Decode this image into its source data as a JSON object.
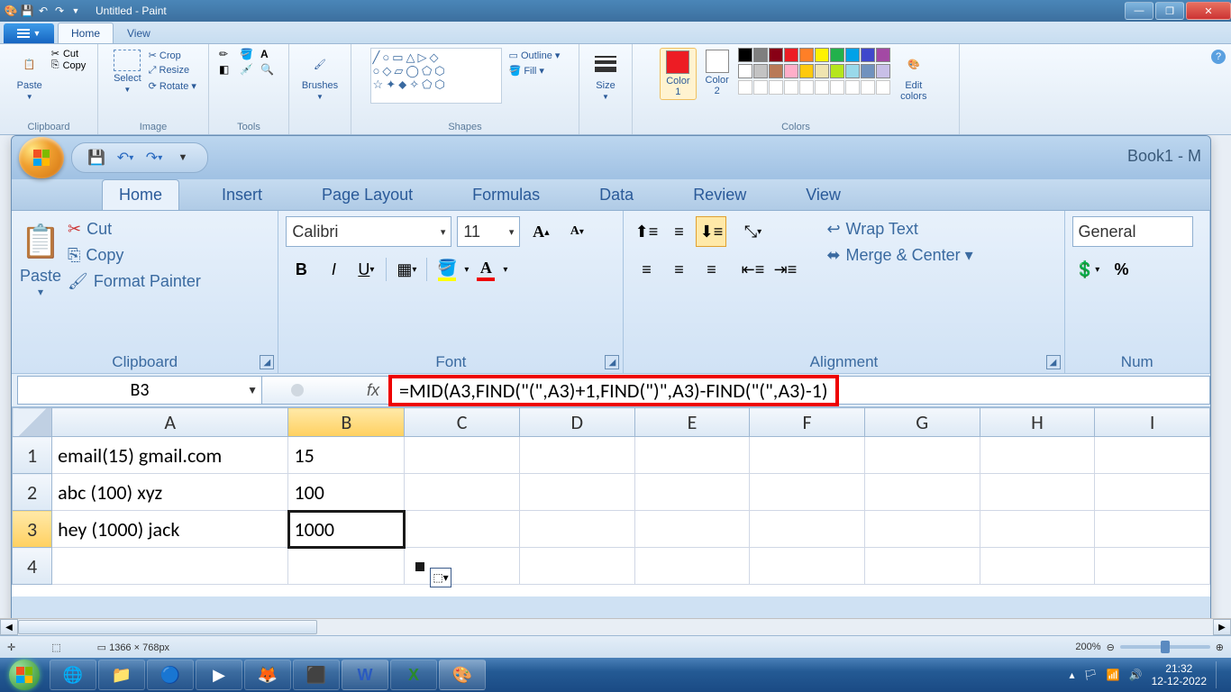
{
  "paint": {
    "title": "Untitled - Paint",
    "file_label": "▾",
    "tabs": {
      "home": "Home",
      "view": "View"
    },
    "clipboard": {
      "paste": "Paste",
      "cut": "Cut",
      "copy": "Copy",
      "label": "Clipboard"
    },
    "image": {
      "select": "Select",
      "crop": "Crop",
      "resize": "Resize",
      "rotate": "Rotate ▾",
      "label": "Image"
    },
    "tools": {
      "label": "Tools"
    },
    "brushes": {
      "label": "Brushes",
      "btn": "Brushes"
    },
    "shapes": {
      "outline": "Outline ▾",
      "fill": "Fill ▾",
      "label": "Shapes"
    },
    "size": {
      "btn": "Size",
      "label": ""
    },
    "colors": {
      "c1": "Color\n1",
      "c2": "Color\n2",
      "edit": "Edit\ncolors",
      "label": "Colors"
    },
    "status": {
      "pos": "",
      "dim": "1366 × 768px",
      "zoom_pct": "200%",
      "sep": "⊟"
    }
  },
  "excel": {
    "book": "Book1 - M",
    "tabs": {
      "home": "Home",
      "insert": "Insert",
      "pagelayout": "Page Layout",
      "formulas": "Formulas",
      "data": "Data",
      "review": "Review",
      "view": "View"
    },
    "clipboard": {
      "paste": "Paste",
      "cut": "Cut",
      "copy": "Copy",
      "formatpainter": "Format Painter",
      "label": "Clipboard"
    },
    "font": {
      "name": "Calibri",
      "size": "11",
      "label": "Font"
    },
    "alignment": {
      "wrap": "Wrap Text",
      "merge": "Merge & Center ▾",
      "label": "Alignment"
    },
    "number": {
      "general": "General",
      "label": "Num"
    },
    "namebox": "B3",
    "fx_label": "fx",
    "formula": "=MID(A3,FIND(\"(\",A3)+1,FIND(\")\",A3)-FIND(\"(\",A3)-1)",
    "cols": [
      "A",
      "B",
      "C",
      "D",
      "E",
      "F",
      "G",
      "H",
      "I"
    ],
    "rows": [
      {
        "n": "1",
        "A": "email(15) gmail.com",
        "B": "15"
      },
      {
        "n": "2",
        "A": "abc (100) xyz",
        "B": "100"
      },
      {
        "n": "3",
        "A": "hey (1000) jack",
        "B": "1000"
      },
      {
        "n": "4",
        "A": "",
        "B": ""
      }
    ]
  },
  "palette": {
    "row1": [
      "#000000",
      "#7f7f7f",
      "#880015",
      "#ed1c24",
      "#ff7f27",
      "#fff200",
      "#22b14c",
      "#00a2e8",
      "#3f48cc",
      "#a349a4"
    ],
    "row2": [
      "#ffffff",
      "#c3c3c3",
      "#b97a57",
      "#ffaec9",
      "#ffc90e",
      "#efe4b0",
      "#b5e61d",
      "#99d9ea",
      "#7092be",
      "#c8bfe7"
    ]
  },
  "taskbar": {
    "time": "21:32",
    "date": "12-12-2022"
  }
}
